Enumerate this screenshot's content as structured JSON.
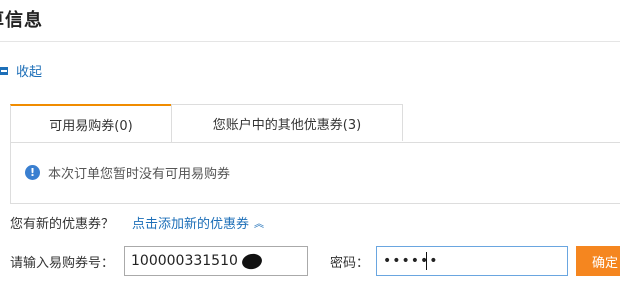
{
  "header": {
    "title": "算信息"
  },
  "collapse": {
    "label": "收起"
  },
  "tabs": [
    {
      "label": "可用易购券(0)",
      "active": true
    },
    {
      "label": "您账户中的其他优惠券(3)",
      "active": false
    }
  ],
  "panel": {
    "message": "本次订单您暂时没有可用易购券"
  },
  "new_coupon": {
    "question": "您有新的优惠券？",
    "add_link": "点击添加新的优惠券"
  },
  "form": {
    "code_label": "请输入易购券号：",
    "code_value": "100000331510",
    "password_label": "密码：",
    "password_value": "••••••",
    "confirm_label": "确定"
  },
  "colors": {
    "accent": "#f08c00",
    "link": "#1d6fb8",
    "confirm_bg": "#f5861f",
    "info_icon": "#3a7fd0"
  },
  "icons": {
    "collapse": "minus-square-icon",
    "info": "exclamation-circle-icon",
    "chevron": "chevron-up-double-icon"
  }
}
